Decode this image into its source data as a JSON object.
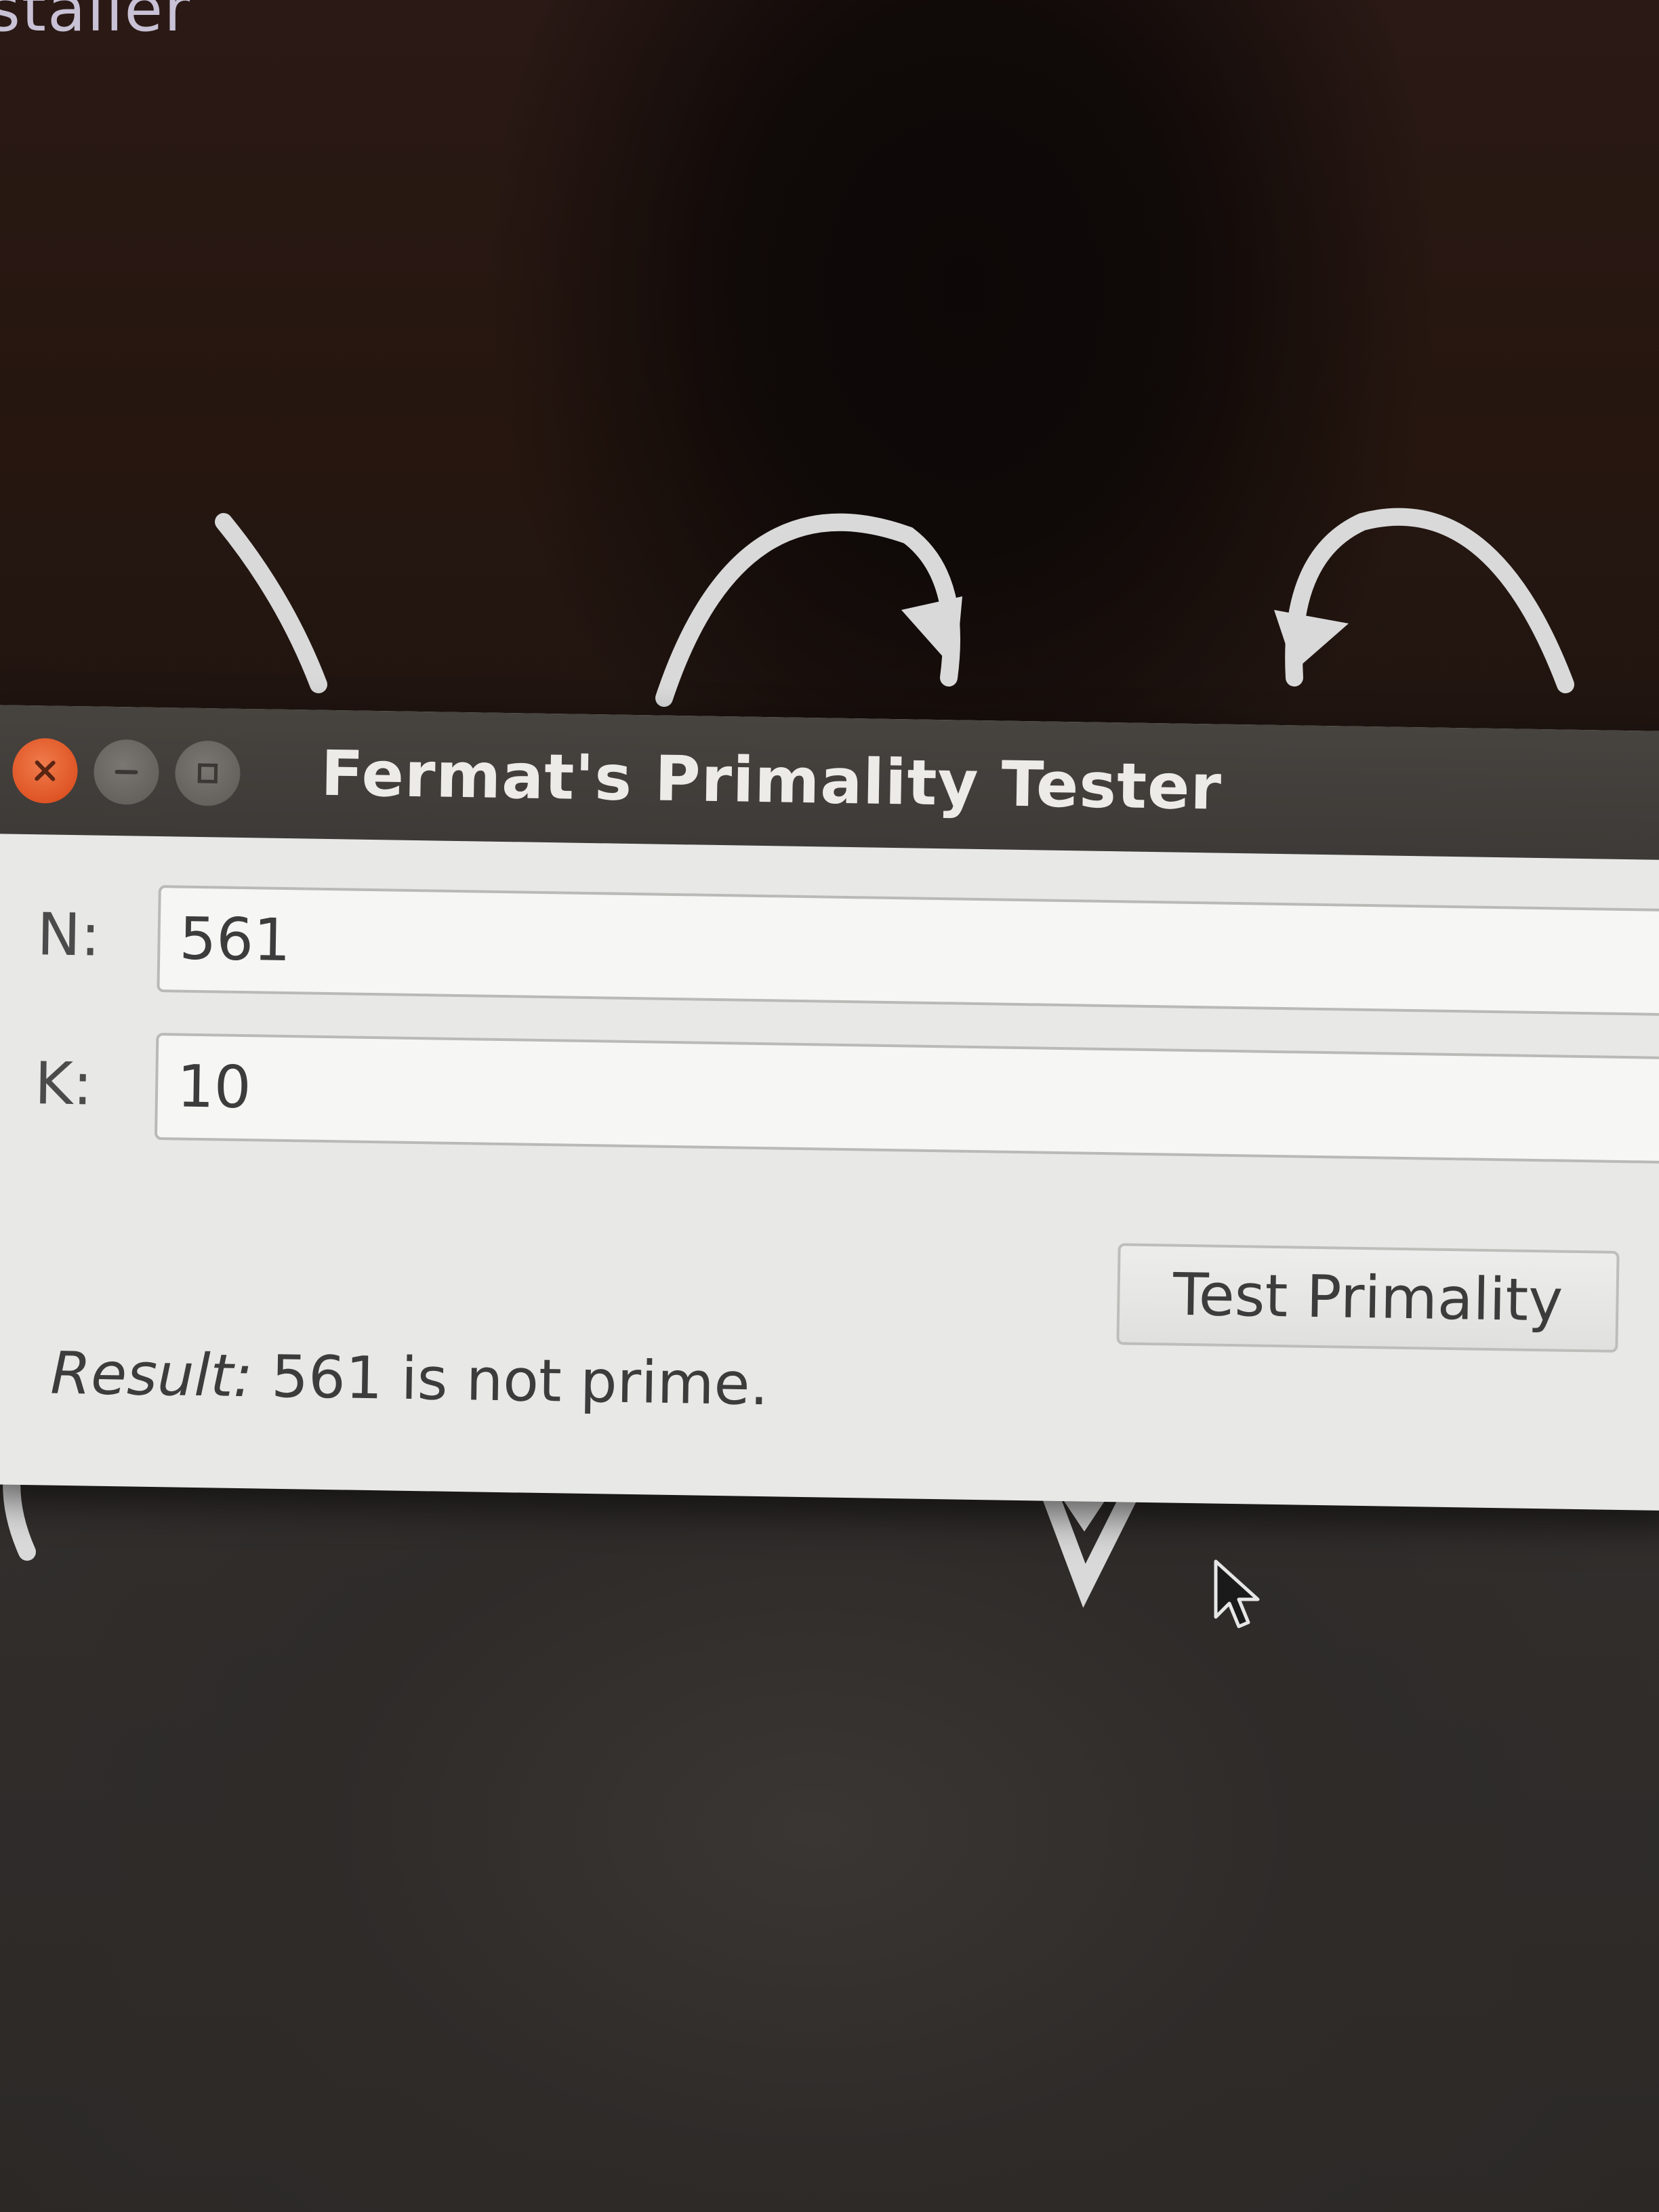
{
  "desktop": {
    "background_label": "staller"
  },
  "window": {
    "title": "Fermat's Primality Tester",
    "controls": {
      "close_glyph": "×",
      "minimize_glyph": "–",
      "maximize_glyph": "□"
    }
  },
  "form": {
    "n_label": "N:",
    "n_value": "561",
    "k_label": "K:",
    "k_value": "10",
    "button_label": "Test Primality",
    "result_label": "Result:",
    "result_text": " 561 is not prime."
  },
  "colors": {
    "close_button": "#df5525",
    "titlebar": "#3d3a37",
    "window_body": "#e8e8e7"
  }
}
